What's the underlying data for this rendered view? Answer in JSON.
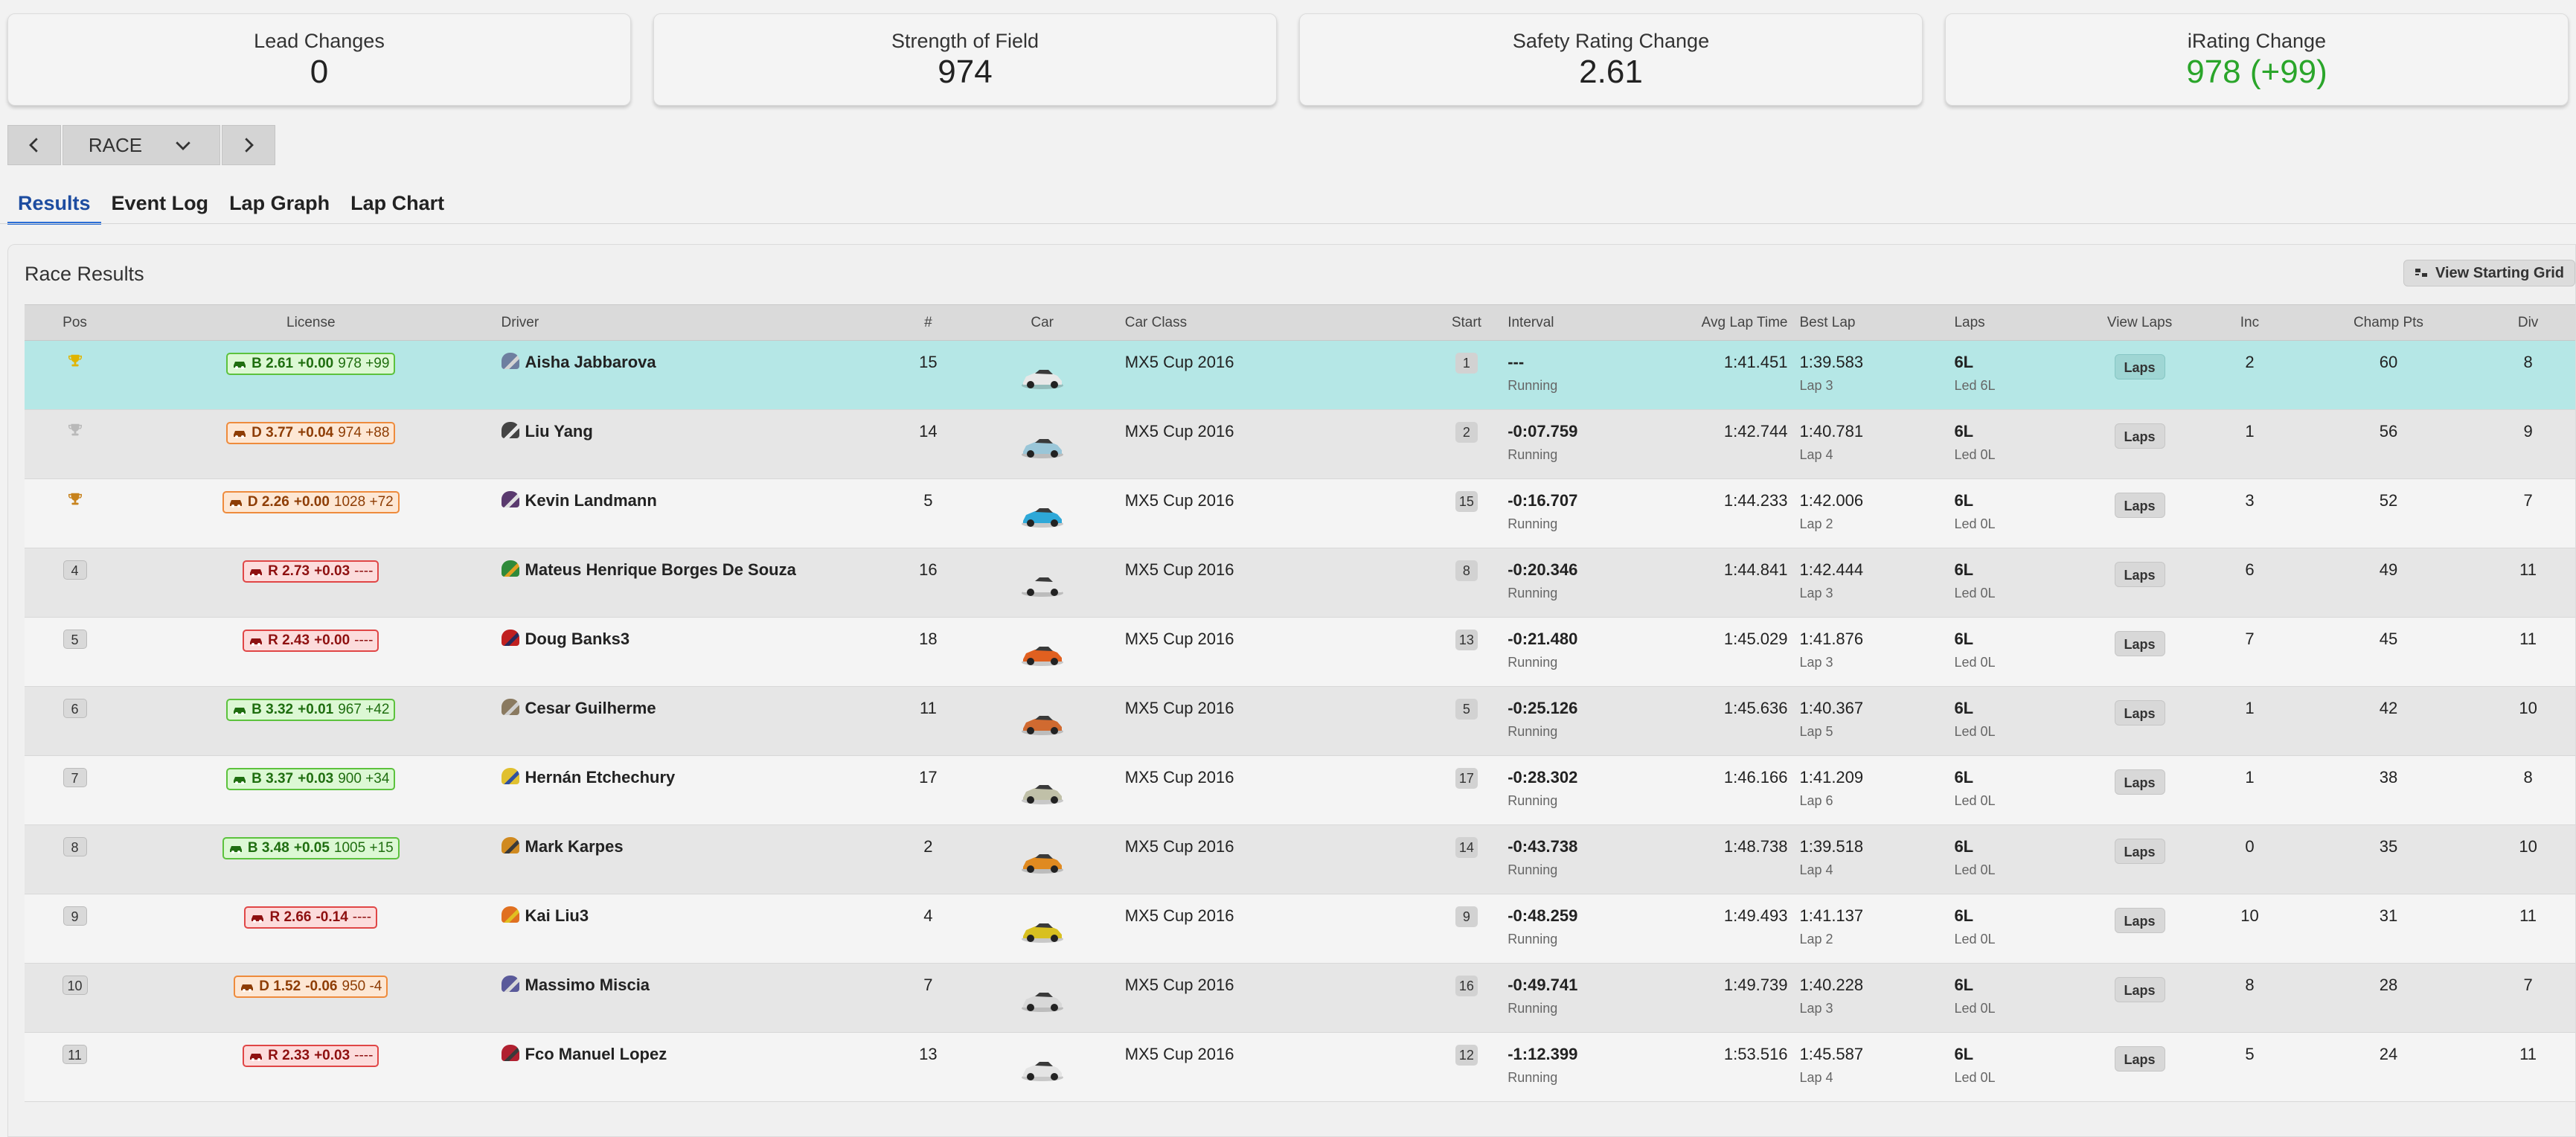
{
  "stats": [
    {
      "label": "Lead Changes",
      "value": "0"
    },
    {
      "label": "Strength of Field",
      "value": "974"
    },
    {
      "label": "Safety Rating Change",
      "value": "2.61"
    },
    {
      "label": "iRating Change",
      "value": "978 (+99)"
    }
  ],
  "session_nav": {
    "selected": "RACE"
  },
  "tabs": [
    "Results",
    "Event Log",
    "Lap Graph",
    "Lap Chart"
  ],
  "panel": {
    "title": "Race Results",
    "grid_button": "View Starting Grid"
  },
  "columns": {
    "pos": "Pos",
    "license": "License",
    "driver": "Driver",
    "num": "#",
    "car": "Car",
    "car_class": "Car Class",
    "start": "Start",
    "interval": "Interval",
    "avg_lap": "Avg Lap Time",
    "best_lap": "Best Lap",
    "laps": "Laps",
    "view_laps": "View Laps",
    "inc": "Inc",
    "champ_pts": "Champ Pts",
    "div": "Div"
  },
  "colors": {
    "gold": "#e0b400",
    "silver": "#b9b9b9",
    "bronze": "#c7821c",
    "highlight": "#b5e7e6",
    "accent": "#2c6fd6",
    "irating_green": "#2aa52a"
  },
  "rows": [
    {
      "pos": "1",
      "trophy": "gold",
      "lic_class": "B",
      "lic_sr": "B 2.61",
      "lic_change": "+0.00",
      "lic_ir": "978 +99",
      "driver": "Aisha Jabbarova",
      "helmet": [
        "#6e7fa0",
        "#d4d4d4"
      ],
      "num": "15",
      "car_color": "#e8e8e8",
      "car_class": "MX5 Cup 2016",
      "start": "1",
      "interval": "---",
      "status": "Running",
      "avg": "1:41.451",
      "best": "1:39.583",
      "best_lap": "Lap 3",
      "laps": "6L",
      "led": "Led 6L",
      "laps_btn": "Laps",
      "inc": "2",
      "pts": "60",
      "div": "8"
    },
    {
      "pos": "2",
      "trophy": "silver",
      "lic_class": "D",
      "lic_sr": "D 3.77",
      "lic_change": "+0.04",
      "lic_ir": "974 +88",
      "driver": "Liu Yang",
      "helmet": [
        "#444444",
        "#e8e8e8"
      ],
      "num": "14",
      "car_color": "#9ac6d8",
      "car_class": "MX5 Cup 2016",
      "start": "2",
      "interval": "-0:07.759",
      "status": "Running",
      "avg": "1:42.744",
      "best": "1:40.781",
      "best_lap": "Lap 4",
      "laps": "6L",
      "led": "Led 0L",
      "laps_btn": "Laps",
      "inc": "1",
      "pts": "56",
      "div": "9"
    },
    {
      "pos": "3",
      "trophy": "bronze",
      "lic_class": "D",
      "lic_sr": "D 2.26",
      "lic_change": "+0.00",
      "lic_ir": "1028 +72",
      "driver": "Kevin Landmann",
      "helmet": [
        "#5a3a6e",
        "#e0e0e0"
      ],
      "num": "5",
      "car_color": "#2ea8d8",
      "car_class": "MX5 Cup 2016",
      "start": "15",
      "interval": "-0:16.707",
      "status": "Running",
      "avg": "1:44.233",
      "best": "1:42.006",
      "best_lap": "Lap 2",
      "laps": "6L",
      "led": "Led 0L",
      "laps_btn": "Laps",
      "inc": "3",
      "pts": "52",
      "div": "7"
    },
    {
      "pos": "4",
      "trophy": "",
      "lic_class": "R",
      "lic_sr": "R 2.73",
      "lic_change": "+0.03",
      "lic_ir": "----",
      "driver": "Mateus Henrique Borges De Souza",
      "helmet": [
        "#2f8a3a",
        "#e0a020"
      ],
      "num": "16",
      "car_color": "#e6e6e6",
      "car_class": "MX5 Cup 2016",
      "start": "8",
      "interval": "-0:20.346",
      "status": "Running",
      "avg": "1:44.841",
      "best": "1:42.444",
      "best_lap": "Lap 3",
      "laps": "6L",
      "led": "Led 0L",
      "laps_btn": "Laps",
      "inc": "6",
      "pts": "49",
      "div": "11"
    },
    {
      "pos": "5",
      "trophy": "",
      "lic_class": "R",
      "lic_sr": "R 2.43",
      "lic_change": "+0.00",
      "lic_ir": "----",
      "driver": "Doug Banks3",
      "helmet": [
        "#c02020",
        "#2a2a5a"
      ],
      "num": "18",
      "car_color": "#e06020",
      "car_class": "MX5 Cup 2016",
      "start": "13",
      "interval": "-0:21.480",
      "status": "Running",
      "avg": "1:45.029",
      "best": "1:41.876",
      "best_lap": "Lap 3",
      "laps": "6L",
      "led": "Led 0L",
      "laps_btn": "Laps",
      "inc": "7",
      "pts": "45",
      "div": "11"
    },
    {
      "pos": "6",
      "trophy": "",
      "lic_class": "B",
      "lic_sr": "B 3.32",
      "lic_change": "+0.01",
      "lic_ir": "967 +42",
      "driver": "Cesar Guilherme",
      "helmet": [
        "#8a7a60",
        "#cfcfcf"
      ],
      "num": "11",
      "car_color": "#d06a30",
      "car_class": "MX5 Cup 2016",
      "start": "5",
      "interval": "-0:25.126",
      "status": "Running",
      "avg": "1:45.636",
      "best": "1:40.367",
      "best_lap": "Lap 5",
      "laps": "6L",
      "led": "Led 0L",
      "laps_btn": "Laps",
      "inc": "1",
      "pts": "42",
      "div": "10"
    },
    {
      "pos": "7",
      "trophy": "",
      "lic_class": "B",
      "lic_sr": "B 3.37",
      "lic_change": "+0.03",
      "lic_ir": "900 +34",
      "driver": "Hernán Etchechury",
      "helmet": [
        "#e0c030",
        "#3050a0"
      ],
      "num": "17",
      "car_color": "#c0c0a8",
      "car_class": "MX5 Cup 2016",
      "start": "17",
      "interval": "-0:28.302",
      "status": "Running",
      "avg": "1:46.166",
      "best": "1:41.209",
      "best_lap": "Lap 6",
      "laps": "6L",
      "led": "Led 0L",
      "laps_btn": "Laps",
      "inc": "1",
      "pts": "38",
      "div": "8"
    },
    {
      "pos": "8",
      "trophy": "",
      "lic_class": "B",
      "lic_sr": "B 3.48",
      "lic_change": "+0.05",
      "lic_ir": "1005 +15",
      "driver": "Mark Karpes",
      "helmet": [
        "#d08a20",
        "#3a3a3a"
      ],
      "num": "2",
      "car_color": "#e08a20",
      "car_class": "MX5 Cup 2016",
      "start": "14",
      "interval": "-0:43.738",
      "status": "Running",
      "avg": "1:48.738",
      "best": "1:39.518",
      "best_lap": "Lap 4",
      "laps": "6L",
      "led": "Led 0L",
      "laps_btn": "Laps",
      "inc": "0",
      "pts": "35",
      "div": "10"
    },
    {
      "pos": "9",
      "trophy": "",
      "lic_class": "R",
      "lic_sr": "R 2.66",
      "lic_change": "-0.14",
      "lic_ir": "----",
      "driver": "Kai Liu3",
      "helmet": [
        "#e07020",
        "#e0c020"
      ],
      "num": "4",
      "car_color": "#d8c020",
      "car_class": "MX5 Cup 2016",
      "start": "9",
      "interval": "-0:48.259",
      "status": "Running",
      "avg": "1:49.493",
      "best": "1:41.137",
      "best_lap": "Lap 2",
      "laps": "6L",
      "led": "Led 0L",
      "laps_btn": "Laps",
      "inc": "10",
      "pts": "31",
      "div": "11"
    },
    {
      "pos": "10",
      "trophy": "",
      "lic_class": "D",
      "lic_sr": "D 1.52",
      "lic_change": "-0.06",
      "lic_ir": "950 -4",
      "driver": "Massimo Miscia",
      "helmet": [
        "#5a5a9a",
        "#d8d8d8"
      ],
      "num": "7",
      "car_color": "#d8d8d8",
      "car_class": "MX5 Cup 2016",
      "start": "16",
      "interval": "-0:49.741",
      "status": "Running",
      "avg": "1:49.739",
      "best": "1:40.228",
      "best_lap": "Lap 3",
      "laps": "6L",
      "led": "Led 0L",
      "laps_btn": "Laps",
      "inc": "8",
      "pts": "28",
      "div": "7"
    },
    {
      "pos": "11",
      "trophy": "",
      "lic_class": "R",
      "lic_sr": "R 2.33",
      "lic_change": "+0.03",
      "lic_ir": "----",
      "driver": "Fco Manuel Lopez",
      "helmet": [
        "#b02030",
        "#3a3a3a"
      ],
      "num": "13",
      "car_color": "#e4e4e4",
      "car_class": "MX5 Cup 2016",
      "start": "12",
      "interval": "-1:12.399",
      "status": "Running",
      "avg": "1:53.516",
      "best": "1:45.587",
      "best_lap": "Lap 4",
      "laps": "6L",
      "led": "Led 0L",
      "laps_btn": "Laps",
      "inc": "5",
      "pts": "24",
      "div": "11"
    }
  ]
}
